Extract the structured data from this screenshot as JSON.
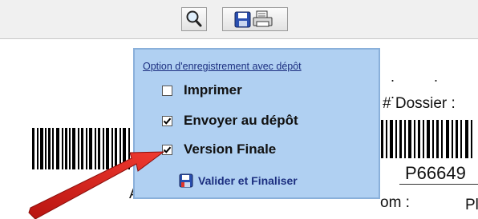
{
  "toolbar": {
    "search_icon": "magnifier-icon",
    "save_print_icons": [
      "floppy-disk-icon",
      "printer-icon"
    ]
  },
  "document": {
    "dots": ". . .",
    "dossier_label": "# Dossier :",
    "dossier_number": "P66649",
    "rom_label": "om :",
    "pl_text": "Pl",
    "left_letter": "A"
  },
  "popup": {
    "title": "Option d'enregistrement avec dépôt",
    "options": [
      {
        "label": "Imprimer",
        "checked": false
      },
      {
        "label": "Envoyer au dépôt",
        "checked": true
      },
      {
        "label": "Version Finale",
        "checked": true
      }
    ],
    "validate_label": "Valider et Finaliser"
  },
  "colors": {
    "panel_bg": "#b0d0f2",
    "title_text": "#1c2f80",
    "annotation_arrow": "#e0201a"
  }
}
